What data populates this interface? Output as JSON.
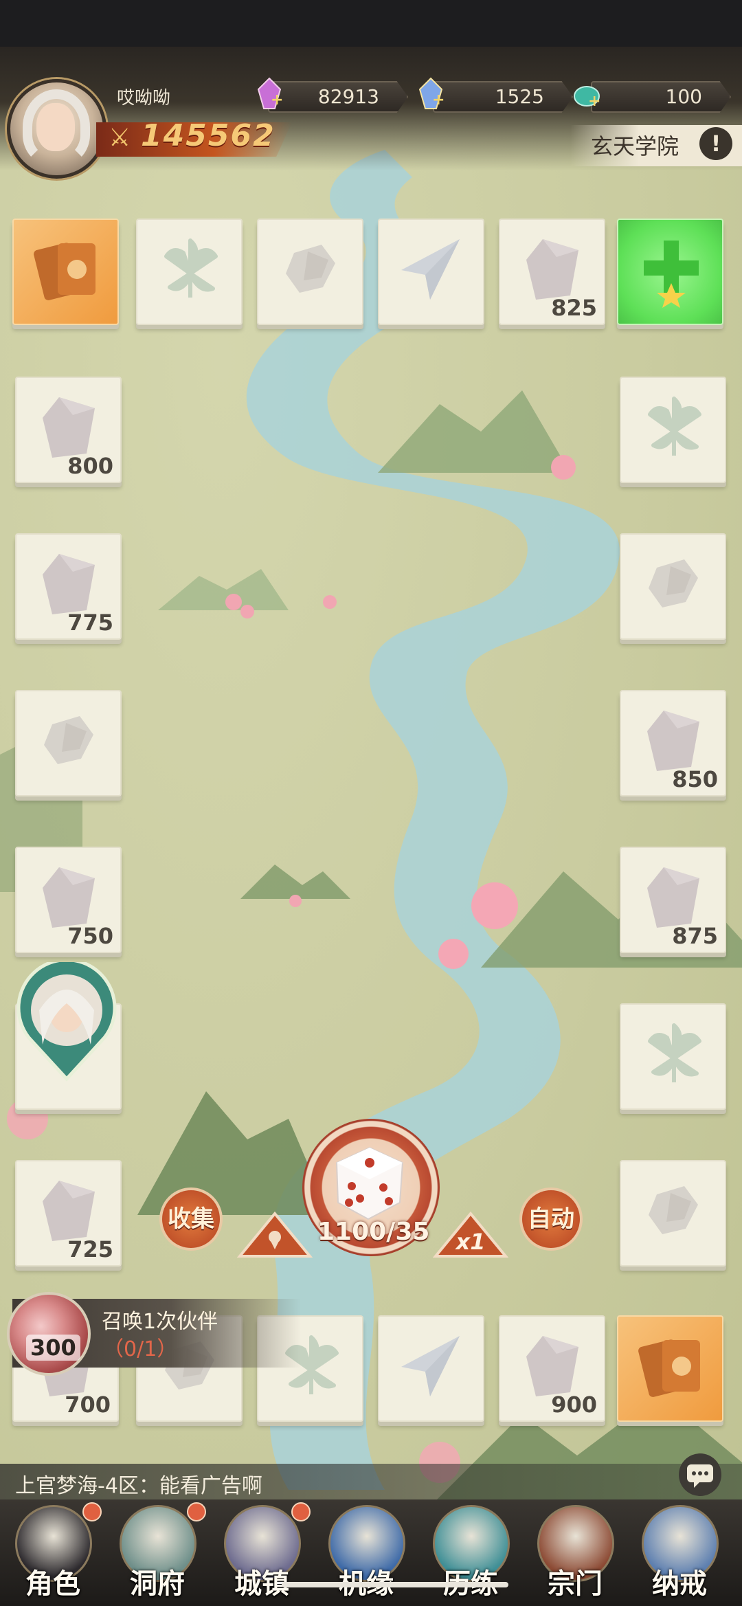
{
  "player": {
    "name": "哎呦呦",
    "power": "145562"
  },
  "resources": [
    {
      "name": "spirit-crystal",
      "value": "82913"
    },
    {
      "name": "rainbow-crystal",
      "value": "1525"
    },
    {
      "name": "jade-stone",
      "value": "100"
    }
  ],
  "location": {
    "label": "玄天学院",
    "info_symbol": "!"
  },
  "board": {
    "tiles": [
      {
        "id": "t1",
        "icon": "card-pack-icon",
        "style": "orange",
        "value": ""
      },
      {
        "id": "t2",
        "icon": "leaf-icon",
        "style": "plain",
        "value": ""
      },
      {
        "id": "t3",
        "icon": "ore-pile-icon",
        "style": "plain",
        "value": ""
      },
      {
        "id": "t4",
        "icon": "paper-plane-icon",
        "style": "plain",
        "value": ""
      },
      {
        "id": "t5",
        "icon": "crystal-icon",
        "style": "plain",
        "value": "825"
      },
      {
        "id": "t6",
        "icon": "plus-star-icon",
        "style": "green",
        "value": ""
      },
      {
        "id": "t7",
        "icon": "crystal-icon",
        "style": "plain",
        "value": "800"
      },
      {
        "id": "t8",
        "icon": "leaf-icon",
        "style": "plain",
        "value": ""
      },
      {
        "id": "t9",
        "icon": "crystal-icon",
        "style": "plain",
        "value": "775"
      },
      {
        "id": "t10",
        "icon": "ore-pile-icon",
        "style": "plain",
        "value": ""
      },
      {
        "id": "t11",
        "icon": "ore-pile-icon",
        "style": "plain",
        "value": ""
      },
      {
        "id": "t12",
        "icon": "crystal-icon",
        "style": "plain",
        "value": "850"
      },
      {
        "id": "t13",
        "icon": "crystal-icon",
        "style": "plain",
        "value": "750"
      },
      {
        "id": "t14",
        "icon": "crystal-icon",
        "style": "plain",
        "value": "875"
      },
      {
        "id": "t15",
        "icon": "player-position-icon",
        "style": "plain",
        "value": ""
      },
      {
        "id": "t16",
        "icon": "leaf-icon",
        "style": "plain",
        "value": ""
      },
      {
        "id": "t17",
        "icon": "crystal-icon",
        "style": "plain",
        "value": "725"
      },
      {
        "id": "t18",
        "icon": "ore-pile-icon",
        "style": "plain",
        "value": ""
      },
      {
        "id": "t19",
        "icon": "crystal-icon",
        "style": "plain",
        "value": "700"
      },
      {
        "id": "t20",
        "icon": "ore-pile-icon",
        "style": "plain",
        "value": ""
      },
      {
        "id": "t21",
        "icon": "leaf-icon",
        "style": "plain",
        "value": ""
      },
      {
        "id": "t22",
        "icon": "paper-plane-icon",
        "style": "plain",
        "value": ""
      },
      {
        "id": "t23",
        "icon": "crystal-icon",
        "style": "plain",
        "value": "900"
      },
      {
        "id": "t24",
        "icon": "card-pack-icon",
        "style": "orange",
        "value": ""
      }
    ]
  },
  "controls": {
    "collect_label": "收集",
    "auto_label": "自动",
    "dice_count": "1100/35",
    "multiplier": "x1"
  },
  "quest": {
    "title": "召唤1次伙伴",
    "progress": "（0/1）",
    "reward_count": "300"
  },
  "chat": {
    "message": "上官梦海-4区：能看广告啊"
  },
  "nav": [
    {
      "label": "角色",
      "icon": "character-icon",
      "badge": true
    },
    {
      "label": "洞府",
      "icon": "cave-mountain-icon",
      "badge": true
    },
    {
      "label": "城镇",
      "icon": "town-icon",
      "badge": true
    },
    {
      "label": "机缘",
      "icon": "fortune-orb-icon",
      "badge": false
    },
    {
      "label": "历练",
      "icon": "training-gate-icon",
      "badge": false
    },
    {
      "label": "宗门",
      "icon": "sect-scroll-icon",
      "badge": false
    },
    {
      "label": "纳戒",
      "icon": "storage-ring-icon",
      "badge": false
    }
  ],
  "colors": {
    "accent_orange": "#c2532a",
    "tile_bg": "#f2efe0",
    "tile_icon": "#c9c6b8",
    "river": "#a9d2d8",
    "green_tile": "#5ee057",
    "badge_red": "#e06040"
  }
}
